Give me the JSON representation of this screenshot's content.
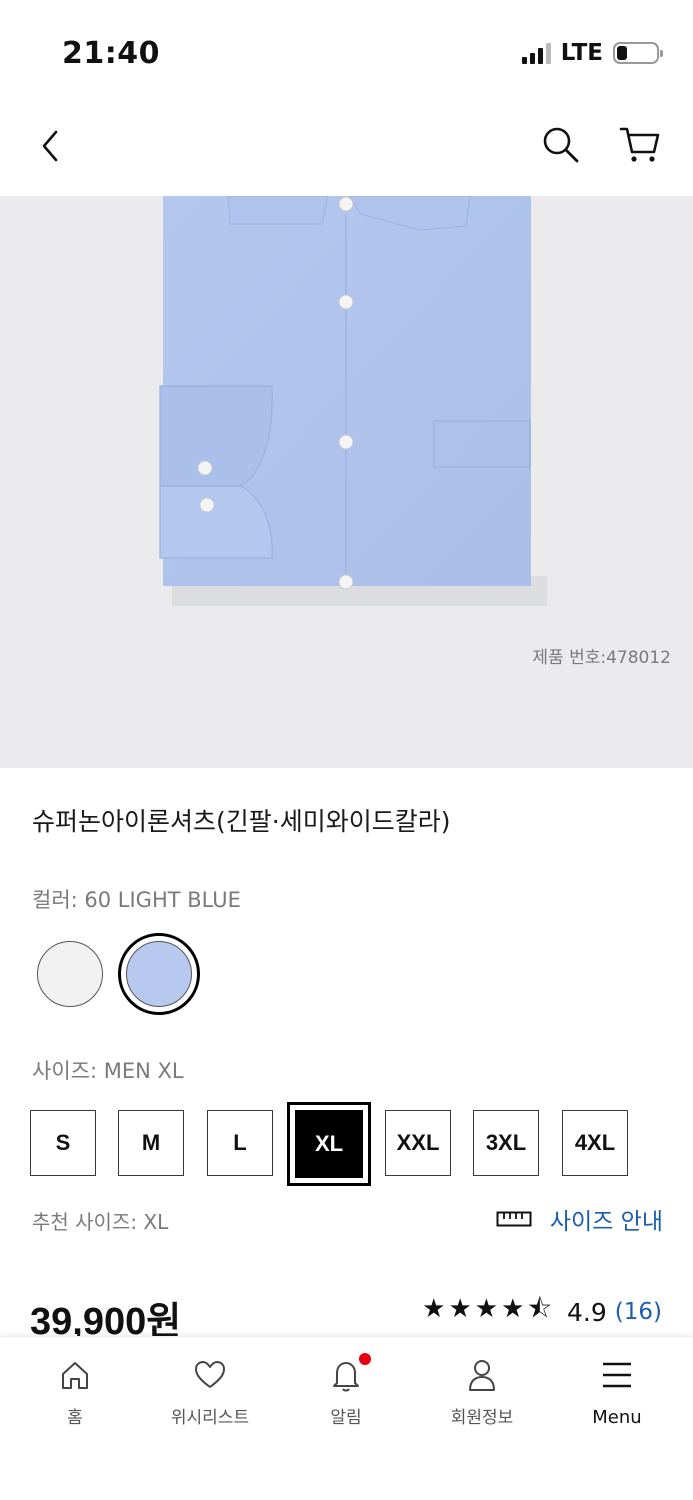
{
  "status_bar": {
    "time": "21:40",
    "network": "LTE"
  },
  "header": {
    "back": "back",
    "search": "search",
    "cart": "cart"
  },
  "product": {
    "number_label": "제품 번호:478012",
    "title": "슈퍼논아이론셔츠(긴팔·세미와이드칼라)",
    "color_label": "컬러: 60 LIGHT BLUE",
    "colors": [
      {
        "hex": "#f2f2f2",
        "selected": false
      },
      {
        "hex": "#b7c9ee",
        "selected": true
      }
    ],
    "size_label": "사이즈: MEN XL",
    "sizes": [
      "S",
      "M",
      "L",
      "XL",
      "XXL",
      "3XL",
      "4XL"
    ],
    "selected_size": "XL",
    "recommended_size": "추천 사이즈: XL",
    "size_guide": "사이즈 안내",
    "price": "39,900원",
    "rating": {
      "stars": "★★★★⯪",
      "value": "4.9",
      "count": "(16)"
    }
  },
  "bottom_nav": {
    "items": [
      {
        "label": "홈",
        "icon": "home-icon"
      },
      {
        "label": "위시리스트",
        "icon": "heart-icon"
      },
      {
        "label": "알림",
        "icon": "bell-icon",
        "badge": true
      },
      {
        "label": "회원정보",
        "icon": "user-icon"
      },
      {
        "label": "Menu",
        "icon": "menu-icon"
      }
    ]
  },
  "colors": {
    "accent_link": "#1b5eb0",
    "badge": "#e60012",
    "image_bg": "#ebebed"
  }
}
